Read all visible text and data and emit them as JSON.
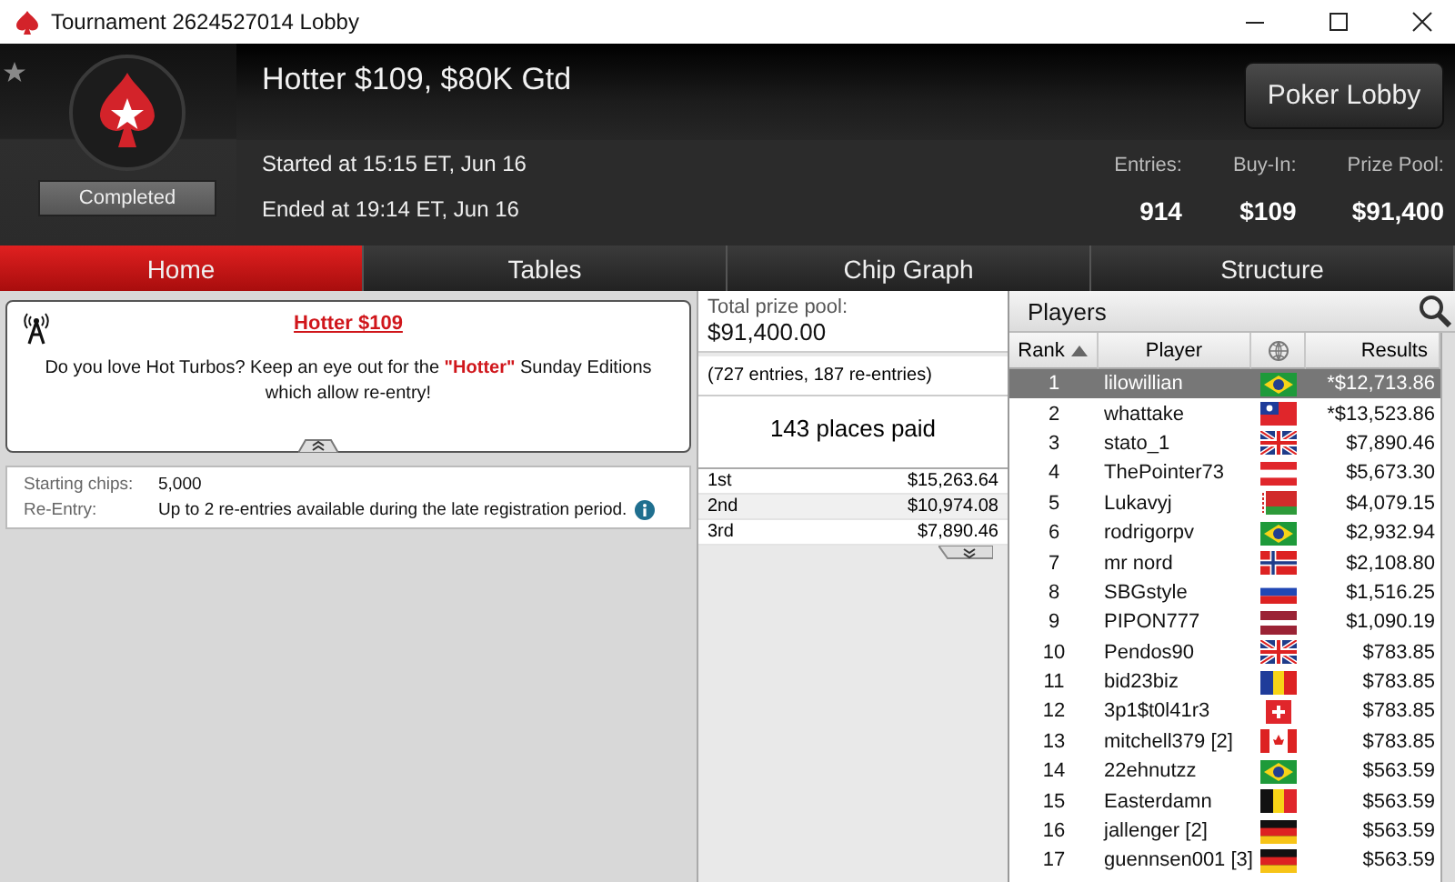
{
  "window": {
    "title": "Tournament 2624527014 Lobby"
  },
  "header": {
    "name": "Hotter $109, $80K Gtd",
    "status": "Completed",
    "started": "Started at 15:15 ET, Jun 16",
    "ended": "Ended at 19:14 ET, Jun 16",
    "lobby_button": "Poker Lobby",
    "stats": [
      {
        "label": "Entries:",
        "value": "914"
      },
      {
        "label": "Buy-In:",
        "value": "$109"
      },
      {
        "label": "Prize Pool:",
        "value": "$91,400"
      }
    ]
  },
  "tabs": [
    {
      "label": "Home",
      "selected": true
    },
    {
      "label": "Tables",
      "selected": false
    },
    {
      "label": "Chip Graph",
      "selected": false
    },
    {
      "label": "Structure",
      "selected": false
    }
  ],
  "news": {
    "title": "Hotter $109",
    "text": "Do you love Hot Turbos? Keep an eye out for the **\"Hotter\"** Sunday Editions which allow re-entry!"
  },
  "details": [
    {
      "label": "Starting chips:",
      "value": "5,000"
    },
    {
      "label": "Re-Entry:",
      "value": "Up to 2 re-entries available during the late registration period.",
      "info": true
    }
  ],
  "prizes": {
    "label": "Total prize pool:",
    "total": "$91,400.00",
    "entries": "(727 entries, 187 re-entries)",
    "paid": "143 places paid",
    "places": [
      {
        "place": "1st",
        "amount": "$15,263.64"
      },
      {
        "place": "2nd",
        "amount": "$10,974.08"
      },
      {
        "place": "3rd",
        "amount": "$7,890.46"
      }
    ]
  },
  "players": {
    "title": "Players",
    "columns": [
      "Rank",
      "Player",
      "Results"
    ],
    "rows": [
      {
        "rank": "1",
        "player": "lilowillian",
        "kind": "br",
        "result": "*$12,713.86",
        "selected": true
      },
      {
        "rank": "2",
        "player": "whattake",
        "kind": "tw",
        "result": "*$13,523.86",
        "selected": false
      },
      {
        "rank": "3",
        "player": "stato_1",
        "kind": "gb",
        "result": "$7,890.46",
        "selected": false
      },
      {
        "rank": "4",
        "player": "ThePointer73",
        "kind": "at",
        "result": "$5,673.30",
        "selected": false
      },
      {
        "rank": "5",
        "player": "Lukavyj",
        "kind": "by",
        "result": "$4,079.15",
        "selected": false
      },
      {
        "rank": "6",
        "player": "rodrigorpv",
        "kind": "br",
        "result": "$2,932.94",
        "selected": false
      },
      {
        "rank": "7",
        "player": "mr nord",
        "kind": "no",
        "result": "$2,108.80",
        "selected": false
      },
      {
        "rank": "8",
        "player": "SBGstyle",
        "kind": "ru",
        "result": "$1,516.25",
        "selected": false
      },
      {
        "rank": "9",
        "player": "PIPON777",
        "kind": "lv",
        "result": "$1,090.19",
        "selected": false
      },
      {
        "rank": "10",
        "player": "Pendos90",
        "kind": "gb",
        "result": "$783.85",
        "selected": false
      },
      {
        "rank": "11",
        "player": "bid23biz",
        "kind": "ro",
        "result": "$783.85",
        "selected": false
      },
      {
        "rank": "12",
        "player": "3p1$t0l41r3",
        "kind": "ch",
        "result": "$783.85",
        "selected": false
      },
      {
        "rank": "13",
        "player": "mitchell379 [2]",
        "kind": "ca",
        "result": "$783.85",
        "selected": false
      },
      {
        "rank": "14",
        "player": "22ehnutzz",
        "kind": "br",
        "result": "$563.59",
        "selected": false
      },
      {
        "rank": "15",
        "player": "Easterdamn",
        "kind": "be",
        "result": "$563.59",
        "selected": false
      },
      {
        "rank": "16",
        "player": "jallenger [2]",
        "kind": "de",
        "result": "$563.59",
        "selected": false
      },
      {
        "rank": "17",
        "player": "guennsen001 [3]",
        "kind": "de",
        "result": "$563.59",
        "selected": false
      }
    ]
  }
}
